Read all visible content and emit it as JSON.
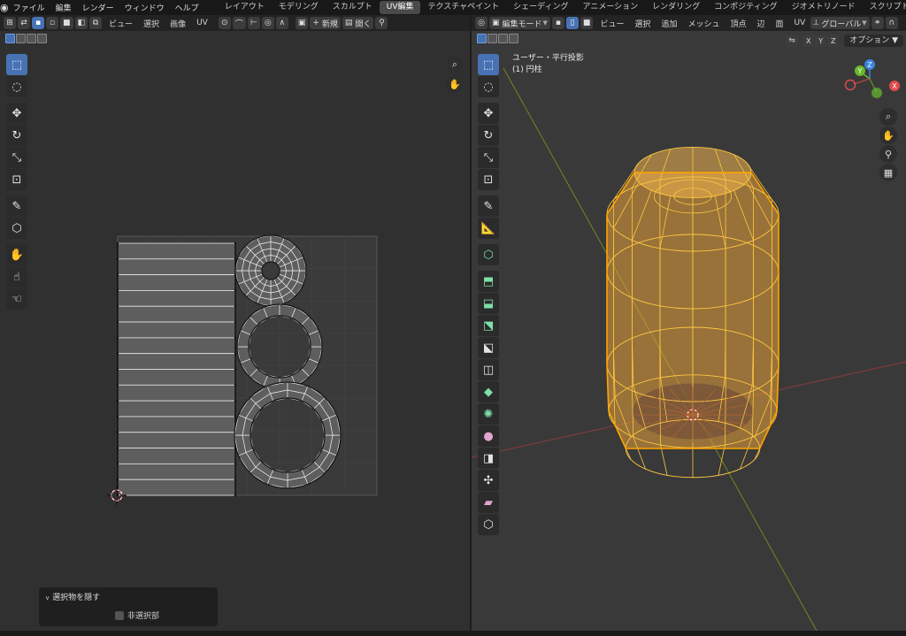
{
  "topbar": {
    "menus": [
      "ファイル",
      "編集",
      "レンダー",
      "ウィンドウ",
      "ヘルプ"
    ],
    "workspaces": [
      "レイアウト",
      "モデリング",
      "スカルプト",
      "UV編集",
      "テクスチャペイント",
      "シェーディング",
      "アニメーション",
      "レンダリング",
      "コンポジティング",
      "ジオメトリノード",
      "スクリプト作成"
    ],
    "active_workspace": "UV編集",
    "add_tab": "+"
  },
  "uv_editor": {
    "header": {
      "view": "ビュー",
      "select": "選択",
      "image": "画像",
      "uv": "UV",
      "new_label": "新規",
      "open_label": "開く"
    },
    "redo_panel": {
      "title": "選択物を隠す",
      "checkbox_label": "非選択部",
      "checked": false
    }
  },
  "viewport": {
    "header": {
      "mode": "編集モード",
      "view": "ビュー",
      "select": "選択",
      "add": "追加",
      "mesh": "メッシュ",
      "vertex": "頂点",
      "edge": "辺",
      "face": "面",
      "uv": "UV",
      "orientation": "グローバル",
      "x": "X",
      "y": "Y",
      "z": "Z",
      "options": "オプション"
    },
    "info": {
      "projection": "ユーザー・平行投影",
      "object": "(1) 円柱"
    },
    "gizmo": {
      "x": "X",
      "y": "Y",
      "z": "Z"
    }
  },
  "colors": {
    "accent": "#4772b3",
    "mesh_orange": "#ffa500",
    "axis_red": "#c44040",
    "axis_green": "#7a9a2a",
    "gizmo_x": "#e24a4a",
    "gizmo_y": "#6ab82c",
    "gizmo_z": "#3b82e0"
  }
}
